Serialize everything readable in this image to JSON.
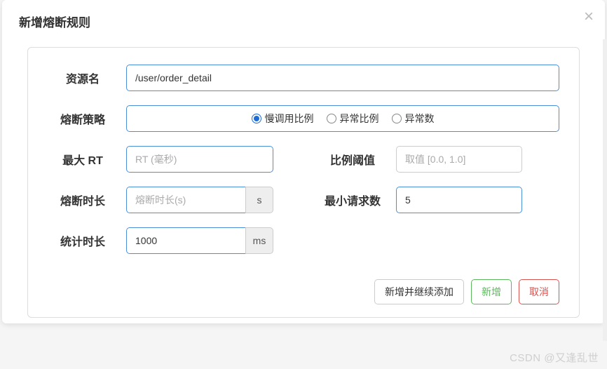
{
  "modal": {
    "title": "新增熔断规则"
  },
  "form": {
    "resource": {
      "label": "资源名",
      "value": "/user/order_detail"
    },
    "strategy": {
      "label": "熔断策略",
      "options": {
        "slow": "慢调用比例",
        "errorRatio": "异常比例",
        "errorCount": "异常数"
      }
    },
    "maxRt": {
      "label": "最大 RT",
      "placeholder": "RT (毫秒)"
    },
    "ratioThreshold": {
      "label": "比例阈值",
      "placeholder": "取值 [0.0, 1.0]"
    },
    "breakDuration": {
      "label": "熔断时长",
      "placeholder": "熔断时长(s)",
      "unit": "s"
    },
    "minRequest": {
      "label": "最小请求数",
      "value": "5"
    },
    "statDuration": {
      "label": "统计时长",
      "value": "1000",
      "unit": "ms"
    }
  },
  "footer": {
    "addContinue": "新增并继续添加",
    "add": "新增",
    "cancel": "取消"
  },
  "watermark": "CSDN @又逢乱世"
}
